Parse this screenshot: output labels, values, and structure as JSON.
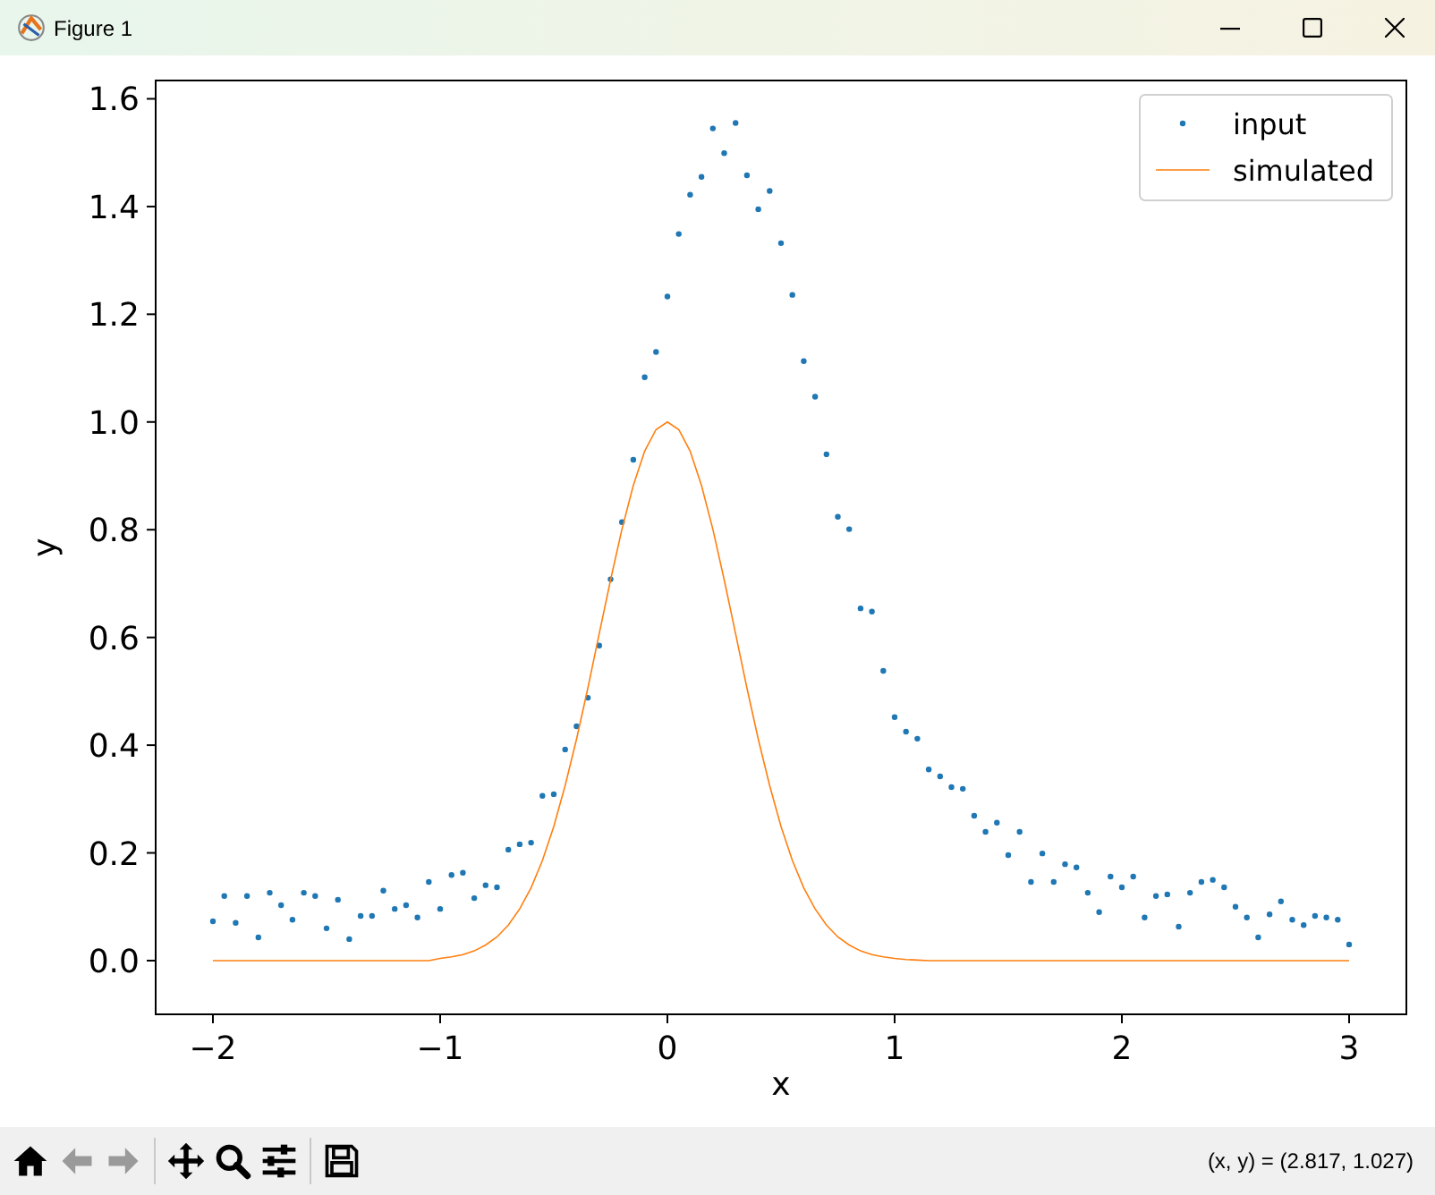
{
  "window": {
    "title": "Figure 1"
  },
  "figure": {
    "chart_data": {
      "type": "scatter",
      "xlabel": "x",
      "ylabel": "y",
      "x": [
        -2,
        -1.95,
        -1.9,
        -1.85,
        -1.8,
        -1.75,
        -1.7,
        -1.65,
        -1.6,
        -1.55,
        -1.5,
        -1.45,
        -1.4,
        -1.35,
        -1.3,
        -1.25,
        -1.2,
        -1.15,
        -1.1,
        -1.05,
        -1,
        -0.95,
        -0.9,
        -0.85,
        -0.8,
        -0.75,
        -0.7,
        -0.65,
        -0.6,
        -0.55,
        -0.5,
        -0.45,
        -0.4,
        -0.35,
        -0.3,
        -0.25,
        -0.2,
        -0.15,
        -0.1,
        -0.05,
        0,
        0.05,
        0.1,
        0.15,
        0.2,
        0.25,
        0.3,
        0.35,
        0.4,
        0.45,
        0.5,
        0.55,
        0.6,
        0.65,
        0.7,
        0.75,
        0.8,
        0.85,
        0.9,
        0.95,
        1,
        1.05,
        1.1,
        1.15,
        1.2,
        1.25,
        1.3,
        1.35,
        1.4,
        1.45,
        1.5,
        1.55,
        1.6,
        1.65,
        1.7,
        1.75,
        1.8,
        1.85,
        1.9,
        1.95,
        2,
        2.05,
        2.1,
        2.15,
        2.2,
        2.25,
        2.3,
        2.35,
        2.4,
        2.45,
        2.5,
        2.55,
        2.6,
        2.65,
        2.7,
        2.75,
        2.8,
        2.85,
        2.9,
        2.95,
        3
      ],
      "series": [
        {
          "name": "input",
          "type": "scatter",
          "color": "#1f77b4",
          "values": [
            0.073,
            0.12,
            0.07,
            0.12,
            0.043,
            0.126,
            0.103,
            0.076,
            0.126,
            0.12,
            0.06,
            0.113,
            0.04,
            0.083,
            0.083,
            0.13,
            0.096,
            0.103,
            0.08,
            0.146,
            0.096,
            0.159,
            0.163,
            0.116,
            0.14,
            0.136,
            0.206,
            0.216,
            0.219,
            0.306,
            0.309,
            0.392,
            0.435,
            0.488,
            0.585,
            0.708,
            0.814,
            0.93,
            1.083,
            1.13,
            1.233,
            1.349,
            1.422,
            1.455,
            1.545,
            1.499,
            1.555,
            1.458,
            1.395,
            1.429,
            1.332,
            1.236,
            1.113,
            1.047,
            0.94,
            0.824,
            0.801,
            0.654,
            0.648,
            0.538,
            0.452,
            0.425,
            0.412,
            0.355,
            0.342,
            0.322,
            0.319,
            0.269,
            0.239,
            0.256,
            0.196,
            0.239,
            0.146,
            0.199,
            0.146,
            0.179,
            0.173,
            0.126,
            0.09,
            0.156,
            0.136,
            0.156,
            0.08,
            0.12,
            0.123,
            0.063,
            0.126,
            0.146,
            0.15,
            0.136,
            0.1,
            0.08,
            0.043,
            0.086,
            0.11,
            0.076,
            0.066,
            0.083,
            0.08,
            0.076,
            0.03
          ]
        },
        {
          "name": "simulated",
          "type": "line",
          "color": "#ff7f0e",
          "values": [
            0,
            0,
            0,
            0,
            0,
            0,
            0,
            0,
            0,
            0,
            0,
            0,
            0,
            0,
            0,
            0,
            0,
            0,
            0,
            0,
            0.004,
            0.007,
            0.011,
            0.018,
            0.029,
            0.044,
            0.066,
            0.096,
            0.135,
            0.186,
            0.249,
            0.325,
            0.411,
            0.506,
            0.607,
            0.707,
            0.801,
            0.882,
            0.946,
            0.986,
            1,
            0.986,
            0.946,
            0.882,
            0.801,
            0.707,
            0.607,
            0.506,
            0.411,
            0.325,
            0.249,
            0.186,
            0.135,
            0.096,
            0.066,
            0.044,
            0.029,
            0.018,
            0.011,
            0.007,
            0.004,
            0.002,
            0.001,
            0,
            0,
            0,
            0,
            0,
            0,
            0,
            0,
            0,
            0,
            0,
            0,
            0,
            0,
            0,
            0,
            0,
            0,
            0,
            0,
            0,
            0,
            0,
            0,
            0,
            0,
            0,
            0,
            0,
            0,
            0,
            0,
            0,
            0,
            0,
            0,
            0,
            0
          ]
        }
      ],
      "legend": true,
      "xlim": [
        -2.252,
        3.252
      ],
      "ylim": [
        -0.0997,
        1.634
      ],
      "xticks": [
        {
          "value": -2,
          "label": "−2"
        },
        {
          "value": -1,
          "label": "−1"
        },
        {
          "value": 0,
          "label": "0"
        },
        {
          "value": 1,
          "label": "1"
        },
        {
          "value": 2,
          "label": "2"
        },
        {
          "value": 3,
          "label": "3"
        }
      ],
      "yticks": [
        {
          "value": 0,
          "label": "0.0"
        },
        {
          "value": 0.2,
          "label": "0.2"
        },
        {
          "value": 0.4,
          "label": "0.4"
        },
        {
          "value": 0.6,
          "label": "0.6"
        },
        {
          "value": 0.8,
          "label": "0.8"
        },
        {
          "value": 1,
          "label": "1.0"
        },
        {
          "value": 1.2,
          "label": "1.2"
        },
        {
          "value": 1.4,
          "label": "1.4"
        },
        {
          "value": 1.6,
          "label": "1.6"
        }
      ]
    }
  },
  "toolbar": {
    "tools": [
      {
        "kind": "home",
        "disabled": false
      },
      {
        "kind": "back",
        "disabled": true
      },
      {
        "kind": "forward",
        "disabled": true
      },
      {
        "kind": "separator"
      },
      {
        "kind": "pan",
        "disabled": false
      },
      {
        "kind": "zoom",
        "disabled": false
      },
      {
        "kind": "configure",
        "disabled": false
      },
      {
        "kind": "separator"
      },
      {
        "kind": "save",
        "disabled": false
      }
    ],
    "coordinates": "(x, y) = (2.817, 1.027)"
  }
}
